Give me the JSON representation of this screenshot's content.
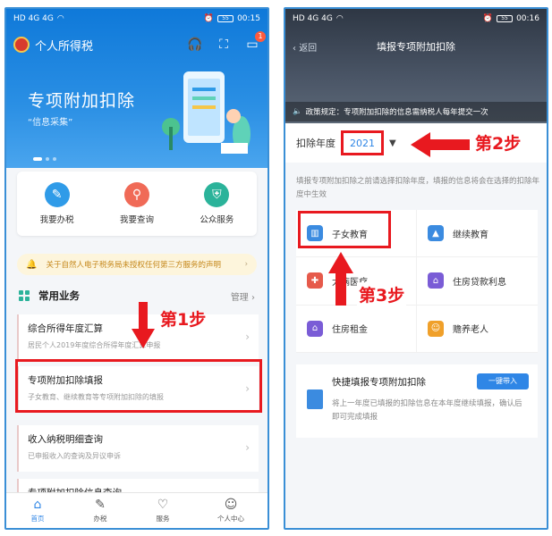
{
  "left_phone": {
    "status": {
      "signal": "HD 4G 4G",
      "time": "00:15",
      "battery": "55"
    },
    "app_title": "个人所得税",
    "header_badge": "1",
    "banner": {
      "title": "专项附加扣除",
      "subtitle": "“信息采集”"
    },
    "quick_actions": [
      {
        "label": "我要办税",
        "icon": "pen-icon",
        "color": "#2f9be8"
      },
      {
        "label": "我要查询",
        "icon": "search-icon",
        "color": "#f06a57"
      },
      {
        "label": "公众服务",
        "icon": "shield-icon",
        "color": "#2bb39a"
      }
    ],
    "notice": "关于自然人电子税务局未授权任何第三方服务的声明",
    "section": {
      "title": "常用业务",
      "manage": "管理"
    },
    "cards": [
      {
        "title": "综合所得年度汇算",
        "sub": "居民个人2019年度综合所得年度汇算申报"
      },
      {
        "title": "专项附加扣除填报",
        "sub": "子女教育、继续教育等专项附加扣除的填报"
      },
      {
        "title": "收入纳税明细查询",
        "sub": "已申报收入的查询及异议申诉"
      },
      {
        "title": "专项附加扣除信息查询",
        "sub": ""
      }
    ],
    "step_label": "第1步",
    "tabs": [
      {
        "label": "首页",
        "icon": "home-icon"
      },
      {
        "label": "办税",
        "icon": "document-icon"
      },
      {
        "label": "服务",
        "icon": "heart-icon"
      },
      {
        "label": "个人中心",
        "icon": "user-icon"
      }
    ]
  },
  "right_phone": {
    "status": {
      "signal": "HD 4G 4G",
      "time": "00:16",
      "battery": "55"
    },
    "back_label": "返回",
    "title": "填报专项附加扣除",
    "policy": "政策规定：专项附加扣除的信息需纳税人每年提交一次",
    "year_label": "扣除年度",
    "year_value": "2021",
    "step2": "第2步",
    "hint": "填报专项附加扣除之前请选择扣除年度，填报的信息将会在选择的扣除年度中生效",
    "categories": [
      {
        "label": "子女教育",
        "icon": "books-icon",
        "color": "#3b8be0"
      },
      {
        "label": "继续教育",
        "icon": "graduation-cap-icon",
        "color": "#3b8be0"
      },
      {
        "label": "大病医疗",
        "icon": "medical-kit-icon",
        "color": "#e65a4b"
      },
      {
        "label": "住房贷款利息",
        "icon": "house-loan-icon",
        "color": "#7a5cd6"
      },
      {
        "label": "住房租金",
        "icon": "house-rent-icon",
        "color": "#7a5cd6"
      },
      {
        "label": "赡养老人",
        "icon": "elderly-icon",
        "color": "#f0a02a"
      }
    ],
    "step3": "第3步",
    "quick_fill": {
      "title": "快捷填报专项附加扣除",
      "button": "一键带入",
      "desc": "将上一年度已填报的扣除信息在本年度继续填报，确认后即可完成填报"
    }
  },
  "colors": {
    "highlight": "#e8191f",
    "primary": "#2f86e6"
  }
}
